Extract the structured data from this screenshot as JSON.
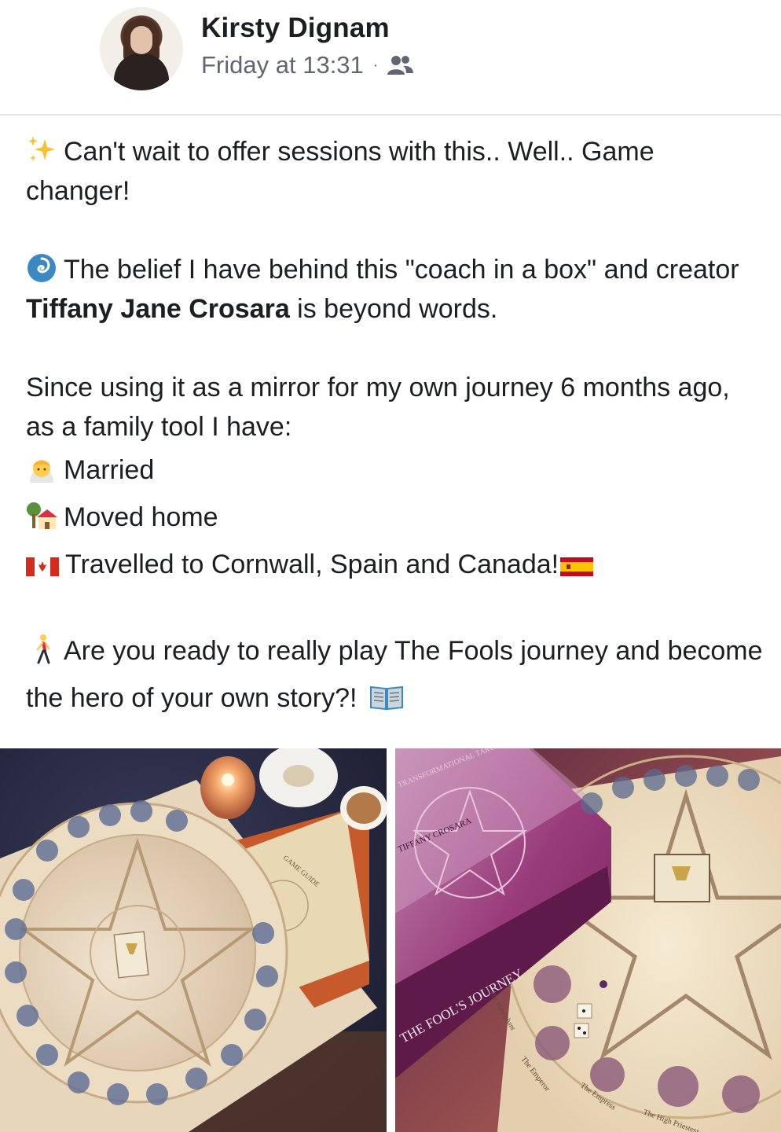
{
  "header": {
    "author": "Kirsty Dignam",
    "timestamp": "Friday at 13:31",
    "separator": "·",
    "audience_icon": "friends-icon"
  },
  "post": {
    "line1": "Can't wait to offer sessions with this.. Well.. Game changer!",
    "line2_prefix": "The belief I have behind this \"coach in a box\" and creator ",
    "line2_bold": "Tiffany Jane Crosara",
    "line2_suffix": " is beyond words.",
    "line3": "Since using it as a mirror for my own journey 6 months ago, as a family tool I have:",
    "list": [
      "Married",
      "Moved home",
      "Travelled to Cornwall, Spain and Canada!"
    ],
    "line4": "Are you ready to really play The Fools journey and become the hero of your own story?!"
  },
  "photos": {
    "left": {
      "game_guide_label": "GAME GUIDE"
    },
    "right": {
      "box_title": "THE FOOL'S JOURNEY",
      "box_brand": "TIFFANY CROSARA",
      "box_top": "TRANSFORMATIONAL TAROT",
      "card_labels": [
        "The Emperor",
        "The Empress",
        "The Hierophant",
        "The High Priestess"
      ]
    }
  },
  "colors": {
    "name": "#1c1e21",
    "meta": "#616770",
    "divider": "#e4e6eb"
  }
}
